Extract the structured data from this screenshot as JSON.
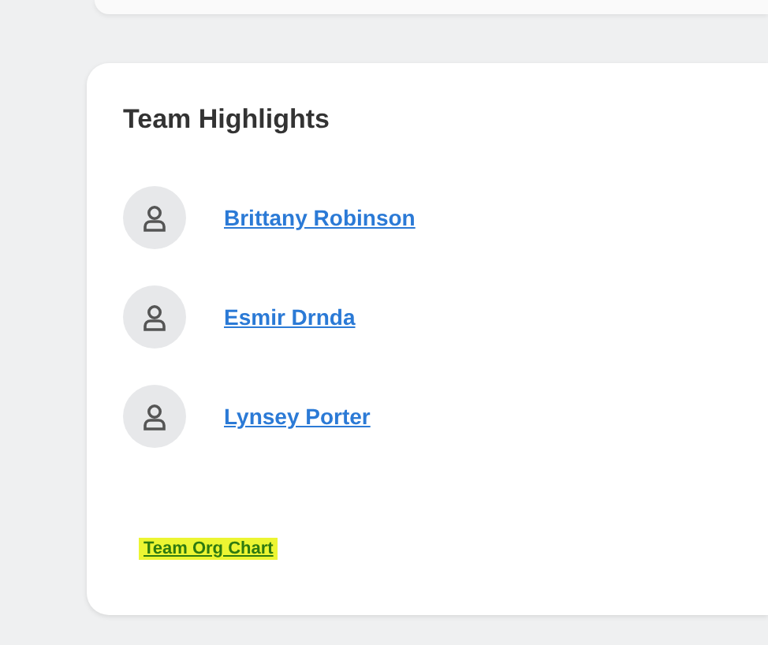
{
  "card": {
    "title": "Team Highlights",
    "members": [
      {
        "name": "Brittany Robinson"
      },
      {
        "name": "Esmir Drnda"
      },
      {
        "name": "Lynsey Porter"
      }
    ],
    "footer_link": {
      "label": "Team Org Chart",
      "highlighted": true
    }
  }
}
